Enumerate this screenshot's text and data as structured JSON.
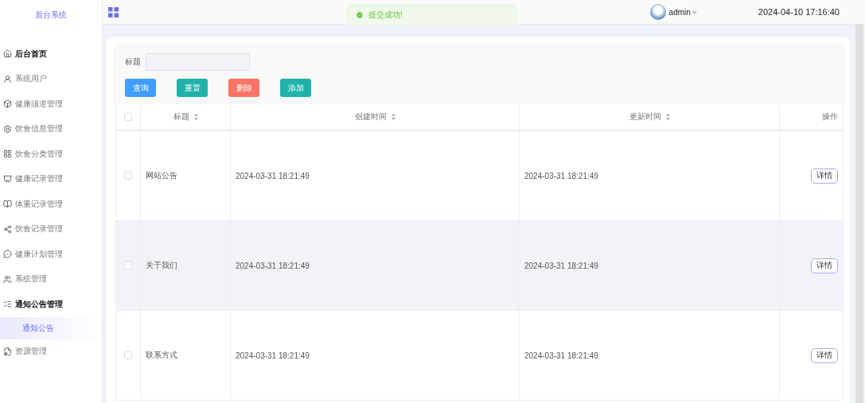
{
  "sidebar": {
    "logo": "后台系统",
    "items": [
      {
        "label": "后台首页",
        "selected": false,
        "expanded": false
      },
      {
        "label": "系统用户",
        "selected": false,
        "expanded": false
      },
      {
        "label": "健康须道管理",
        "selected": false,
        "expanded": false
      },
      {
        "label": "饮食信息管理",
        "selected": false,
        "expanded": false
      },
      {
        "label": "饮食分类管理",
        "selected": false,
        "expanded": false
      },
      {
        "label": "健康记录管理",
        "selected": false,
        "expanded": false
      },
      {
        "label": "体重记录管理",
        "selected": false,
        "expanded": false
      },
      {
        "label": "饮食记录管理",
        "selected": false,
        "expanded": false
      },
      {
        "label": "健康计划管理",
        "selected": false,
        "expanded": false
      },
      {
        "label": "系统管理",
        "selected": false,
        "expanded": false
      },
      {
        "label": "通知公告管理",
        "selected": false,
        "expanded": true,
        "children": [
          {
            "label": "通知公告",
            "selected": true
          }
        ]
      },
      {
        "label": "资源管理",
        "selected": false,
        "expanded": false
      }
    ]
  },
  "header": {
    "user": "admin",
    "datetime": "2024-04-10 17:16:40"
  },
  "toast": {
    "message": "提交成功!"
  },
  "search": {
    "label": "标题"
  },
  "buttons": [
    {
      "label": "查询",
      "color": "#409eff"
    },
    {
      "label": "重置",
      "color": "#20b2aa"
    },
    {
      "label": "删除",
      "color": "#fa7464"
    },
    {
      "label": "添加",
      "color": "#20b2aa"
    }
  ],
  "table": {
    "all_checked": false,
    "columns": [
      {
        "label": "标题",
        "sortable": true
      },
      {
        "label": "创建时间",
        "sortable": true
      },
      {
        "label": "更新时间",
        "sortable": true
      },
      {
        "label": "操作",
        "sortable": false
      }
    ],
    "rows": [
      {
        "title": "网站公告",
        "created": "2024-03-31 18:21:49",
        "updated": "2024-03-31 18:21:49",
        "action": "详情",
        "checked": false,
        "hovered": false
      },
      {
        "title": "关于我们",
        "created": "2024-03-31 18:21:49",
        "updated": "2024-03-31 18:21:49",
        "action": "详情",
        "checked": false,
        "hovered": true
      },
      {
        "title": "联系方式",
        "created": "2024-03-31 18:21:49",
        "updated": "2024-03-31 18:21:49",
        "action": "详情",
        "checked": false,
        "hovered": false
      }
    ]
  }
}
